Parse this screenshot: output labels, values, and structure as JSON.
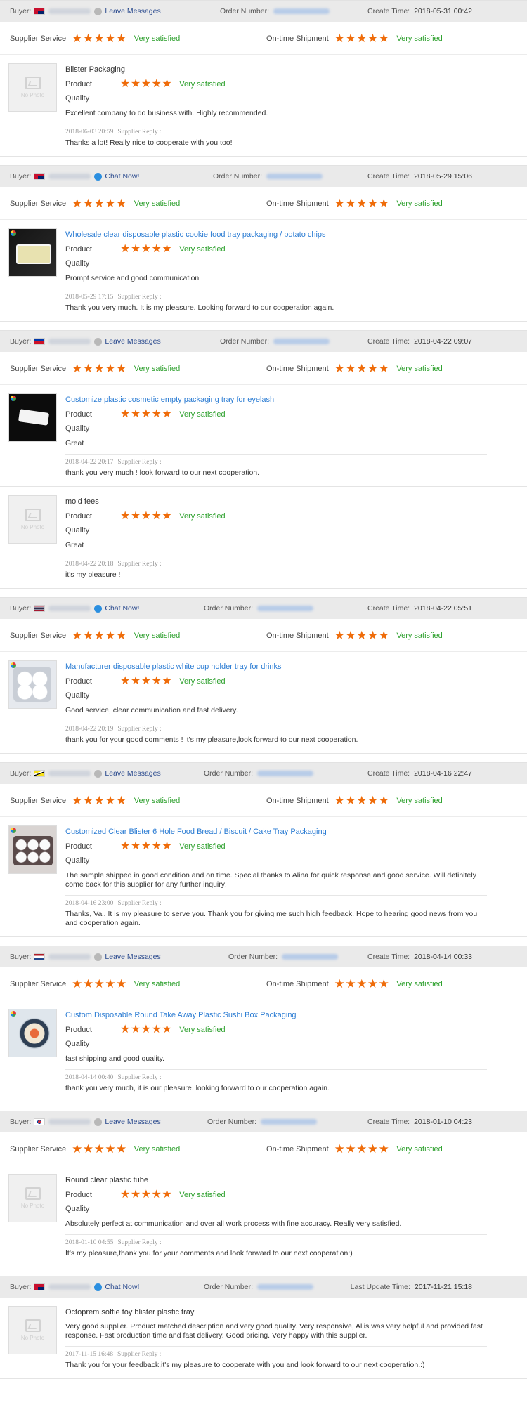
{
  "labels": {
    "buyer": "Buyer:",
    "order_number": "Order Number:",
    "create_time": "Create Time:",
    "last_update_time": "Last Update Time:",
    "supplier_service": "Supplier Service",
    "on_time_shipment": "On-time Shipment",
    "product": "Product",
    "quality": "Quality",
    "supplier_reply": "Supplier Reply :",
    "stars": "★★★★★",
    "very_satisfied": "Very satisfied",
    "no_photo": "No Photo",
    "leave_messages": "Leave Messages",
    "chat_now": "Chat Now!"
  },
  "colors": {
    "star": "#ef6c0a",
    "satisfied": "#2fa12f",
    "link": "#2b7cd3",
    "header_bg": "#eaeaea"
  },
  "orders": [
    {
      "flag": "australia",
      "contact": "Leave Messages",
      "time_label": "Create Time:",
      "time": "2018-05-31 00:42",
      "items": [
        {
          "thumb": "no-photo",
          "name": "Blister Packaging",
          "rating_text": "Very satisfied",
          "comment": "Excellent company to do business with. Highly recommended.",
          "reply_time": "2018-06-03 20:59",
          "reply": "Thanks a lot! Really nice to cooperate with you too!"
        }
      ]
    },
    {
      "flag": "australia",
      "contact": "Chat Now!",
      "time_label": "Create Time:",
      "time": "2018-05-29 15:06",
      "items": [
        {
          "thumb": "cookie-tray",
          "name": "Wholesale clear disposable plastic cookie food tray packaging / potato chips",
          "rating_text": "Very satisfied",
          "comment": "Prompt service and good communication",
          "reply_time": "2018-05-29 17:15",
          "reply": "Thank you very much. It is my pleasure. Looking forward to our cooperation again."
        }
      ]
    },
    {
      "flag": "philippines",
      "contact": "Leave Messages",
      "time_label": "Create Time:",
      "time": "2018-04-22 09:07",
      "items": [
        {
          "thumb": "eyelash-tray",
          "name": "Customize plastic cosmetic empty packaging tray for eyelash",
          "rating_text": "Very satisfied",
          "comment": "Great",
          "reply_time": "2018-04-22 20:17",
          "reply": "thank you very much ! look forward to our next cooperation."
        },
        {
          "thumb": "no-photo",
          "name": "mold fees",
          "rating_text": "Very satisfied",
          "comment": "Great",
          "reply_time": "2018-04-22 20:18",
          "reply": "it's my pleasure !"
        }
      ]
    },
    {
      "flag": "thailand",
      "contact": "Chat Now!",
      "time_label": "Create Time:",
      "time": "2018-04-22 05:51",
      "items": [
        {
          "thumb": "cup-holder",
          "name": "Manufacturer disposable plastic white cup holder tray for drinks",
          "rating_text": "Very satisfied",
          "comment": "Good service, clear communication and fast delivery.",
          "reply_time": "2018-04-22 20:19",
          "reply": "thank you for your good comments ! it's my pleasure,look forward to our next cooperation."
        }
      ]
    },
    {
      "flag": "brunei",
      "contact": "Leave Messages",
      "time_label": "Create Time:",
      "time": "2018-04-16 22:47",
      "items": [
        {
          "thumb": "bread-tray",
          "name": "Customized Clear Blister 6 Hole Food Bread / Biscuit / Cake Tray Packaging",
          "rating_text": "Very satisfied",
          "comment": "The sample shipped in good condition and on time. Special thanks to Alina for quick response and good service. Will definitely come back for this supplier for any further inquiry!",
          "reply_time": "2018-04-16 23:00",
          "reply": "Thanks, Val. It is my pleasure to serve you. Thank you for giving me such high feedback. Hope to hearing good news from you and cooperation again."
        }
      ]
    },
    {
      "flag": "netherlands",
      "contact": "Leave Messages",
      "time_label": "Create Time:",
      "time": "2018-04-14 00:33",
      "items": [
        {
          "thumb": "sushi-box",
          "name": "Custom Disposable Round Take Away Plastic Sushi Box Packaging",
          "rating_text": "Very satisfied",
          "comment": "fast shipping and good quality.",
          "reply_time": "2018-04-14 00:40",
          "reply": "thank you very much, it is our pleasure. looking forward to our cooperation again."
        }
      ]
    },
    {
      "flag": "korea",
      "contact": "Leave Messages",
      "time_label": "Create Time:",
      "time": "2018-01-10 04:23",
      "items": [
        {
          "thumb": "no-photo",
          "name": "Round clear plastic tube",
          "rating_text": "Very satisfied",
          "comment": "Absolutely perfect at communication and over all work process with fine accuracy. Really very satisfied.",
          "reply_time": "2018-01-10 04:55",
          "reply": "It's my pleasure,thank you for your comments and look forward to our next cooperation:)"
        }
      ]
    },
    {
      "flag": "australia",
      "contact": "Chat Now!",
      "time_label": "Last Update Time:",
      "time": "2017-11-21 15:18",
      "items": [
        {
          "thumb": "no-photo",
          "name": "Octoprem softie toy blister plastic tray",
          "rating_text": "",
          "comment": "Very good supplier. Product matched description and very good quality. Very responsive, Allis was very helpful and provided fast response.  Fast production time and fast delivery. Good pricing. Very happy with this supplier.",
          "reply_time": "2017-11-15 16:48",
          "reply": "Thank you for your feedback,it's my pleasure to cooperate with you and look forward to our next cooperation.:)"
        }
      ]
    }
  ]
}
